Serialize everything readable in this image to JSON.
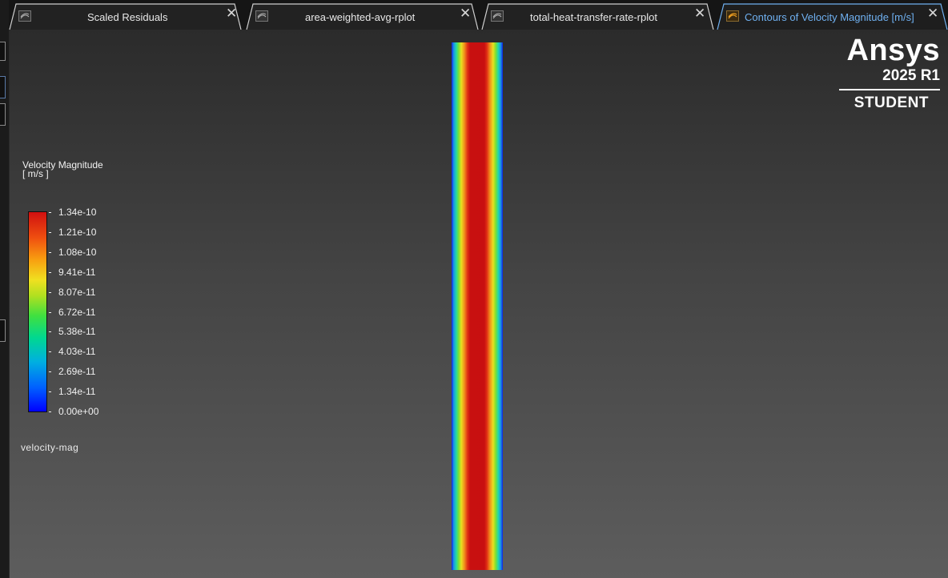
{
  "tabs": [
    {
      "label": "Scaled Residuals",
      "icon": "plot-icon",
      "active": false
    },
    {
      "label": "area-weighted-avg-rplot",
      "icon": "plot-icon",
      "active": false
    },
    {
      "label": "total-heat-transfer-rate-rplot",
      "icon": "plot-icon",
      "active": false
    },
    {
      "label": "Contours of Velocity Magnitude [m/s]",
      "icon": "contour-icon",
      "active": true
    }
  ],
  "legend": {
    "title_line1": "Velocity Magnitude",
    "title_line2": "[ m/s ]",
    "ticks": [
      "1.34e-10",
      "1.21e-10",
      "1.08e-10",
      "9.41e-11",
      "8.07e-11",
      "6.72e-11",
      "5.38e-11",
      "4.03e-11",
      "2.69e-11",
      "1.34e-11",
      "0.00e+00"
    ],
    "colormap": "rainbow",
    "variable": "velocity-mag"
  },
  "logo": {
    "brand": "Ansys",
    "version": "2025 R1",
    "edition": "STUDENT"
  },
  "colors": {
    "active_tab_text": "#6fb0f0",
    "viewport_top": "#2b2b2b",
    "viewport_bottom": "#5d5d5d"
  }
}
